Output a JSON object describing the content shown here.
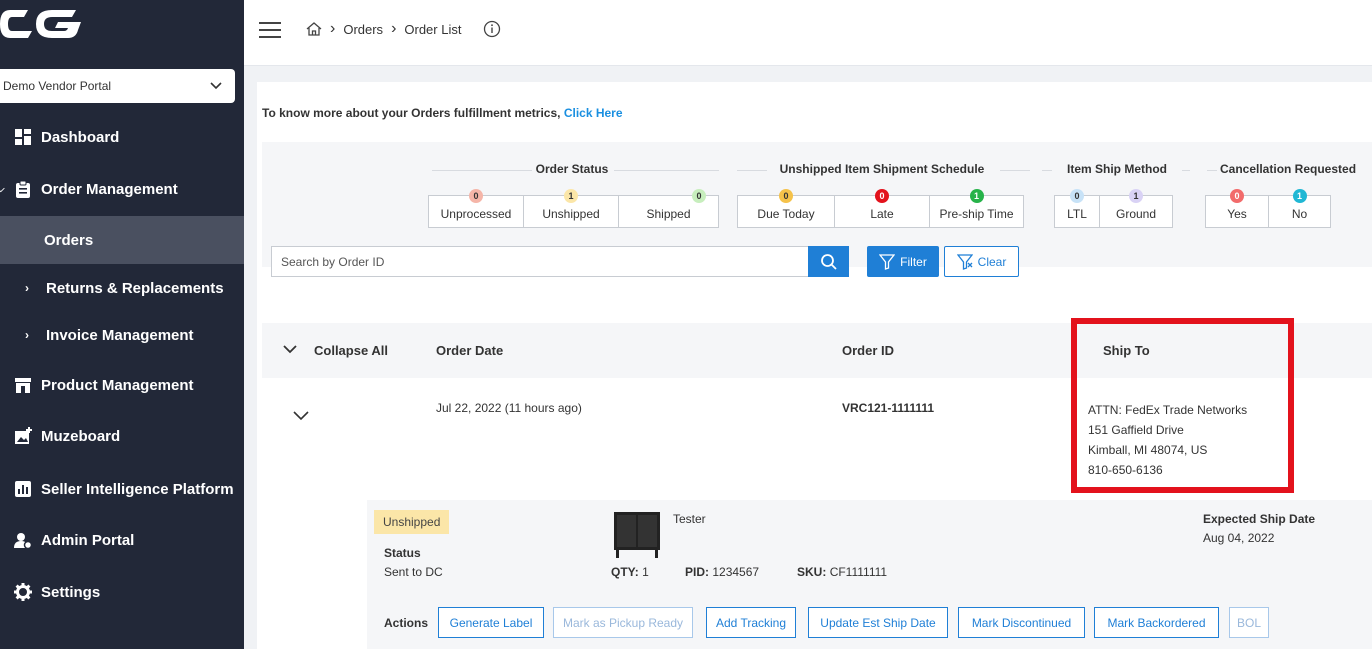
{
  "sidebar": {
    "logo_text": "CG",
    "vendor_select": "Demo Vendor Portal",
    "items": [
      {
        "label": "Dashboard"
      },
      {
        "label": "Order Management"
      },
      {
        "label": "Orders"
      },
      {
        "label": "Returns & Replacements"
      },
      {
        "label": "Invoice Management"
      },
      {
        "label": "Product Management"
      },
      {
        "label": "Muzeboard"
      },
      {
        "label": "Seller Intelligence Platform"
      },
      {
        "label": "Admin Portal"
      },
      {
        "label": "Settings"
      }
    ]
  },
  "breadcrumb": [
    "Orders",
    "Order List"
  ],
  "metrics": {
    "text": "To know more about your Orders fulfillment metrics, ",
    "link": "Click Here"
  },
  "status_groups": [
    {
      "title": "Order Status",
      "items": [
        {
          "label": "Unprocessed",
          "count": "0",
          "color": "#f5b5a8"
        },
        {
          "label": "Unshipped",
          "count": "1",
          "color": "#fbe6a8"
        },
        {
          "label": "Shipped",
          "count": "0",
          "color": "#c7eebd"
        }
      ]
    },
    {
      "title": "Unshipped Item Shipment Schedule",
      "items": [
        {
          "label": "Due Today",
          "count": "0",
          "color": "#f5c24a"
        },
        {
          "label": "Late",
          "count": "0",
          "color": "#e3121c"
        },
        {
          "label": "Pre-ship Time",
          "count": "1",
          "color": "#27b34a"
        }
      ]
    },
    {
      "title": "Item Ship Method",
      "items": [
        {
          "label": "LTL",
          "count": "0",
          "color": "#c7e2f7"
        },
        {
          "label": "Ground",
          "count": "1",
          "color": "#d9d2f5"
        }
      ]
    },
    {
      "title": "Cancellation Requested",
      "items": [
        {
          "label": "Yes",
          "count": "0",
          "color": "#f26b6b"
        },
        {
          "label": "No",
          "count": "1",
          "color": "#20b7d4"
        }
      ]
    }
  ],
  "search": {
    "placeholder": "Search by Order ID"
  },
  "filter_label": "Filter",
  "clear_label": "Clear",
  "table": {
    "collapse_all": "Collapse All",
    "headers": {
      "order_date": "Order Date",
      "order_id": "Order ID",
      "ship_to": "Ship To"
    },
    "row": {
      "order_date": "Jul 22, 2022 (11 hours ago)",
      "order_id": "VRC121-1111111",
      "ship_to": [
        "ATTN: FedEx Trade Networks",
        "151 Gaffield Drive",
        "Kimball, MI 48074, US",
        "810-650-6136"
      ]
    }
  },
  "detail": {
    "status_pill": "Unshipped",
    "status_label": "Status",
    "status_value": "Sent to DC",
    "product_name": "Tester",
    "qty_label": "QTY:",
    "qty": "1",
    "pid_label": "PID:",
    "pid": "1234567",
    "sku_label": "SKU:",
    "sku": "CF1111111",
    "expected_label": "Expected Ship Date",
    "expected_value": "Aug 04, 2022",
    "actions_label": "Actions",
    "actions": [
      "Generate Label",
      "Mark as Pickup Ready",
      "Add Tracking",
      "Update Est Ship Date",
      "Mark Discontinued",
      "Mark Backordered",
      "BOL"
    ]
  }
}
